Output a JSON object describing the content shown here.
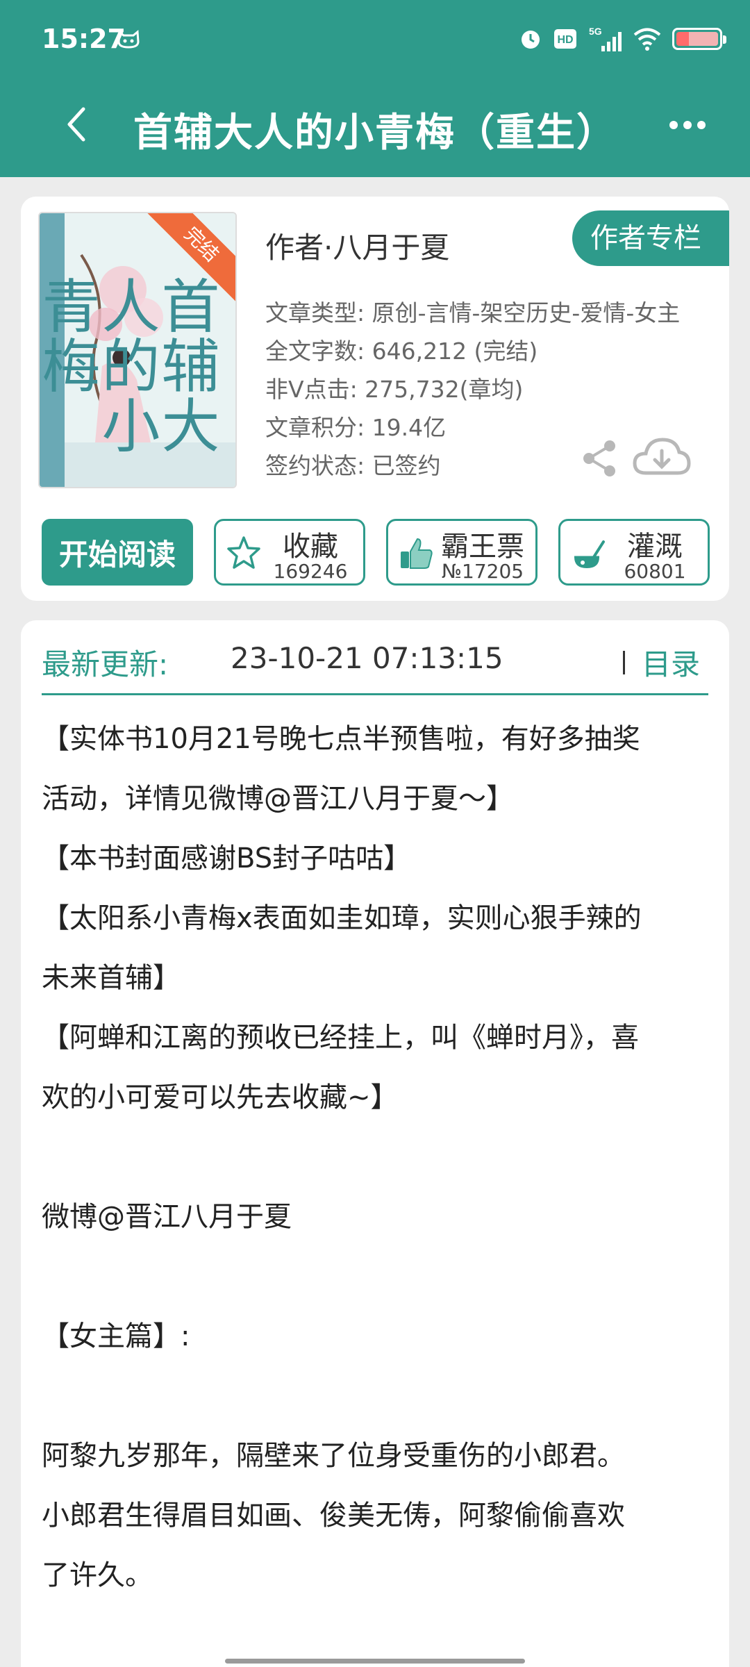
{
  "status_bar": {
    "time": "15:27",
    "icons": [
      "cat-icon",
      "alarm-icon",
      "hd-icon",
      "signal-5g-icon",
      "wifi-icon",
      "battery-icon"
    ],
    "network_label": "5G",
    "hd_label": "HD"
  },
  "header": {
    "title": "首辅大人的小青梅（重生）",
    "back_icon": "chevron-left-icon",
    "more_icon": "more-dots-icon"
  },
  "book": {
    "cover_badge": "完结",
    "cover_title": "首辅大人的小青梅",
    "author_label": "作者·八月于夏",
    "author_column_button": "作者专栏",
    "info": [
      "文章类型: 原创-言情-架空历史-爱情-女主",
      "全文字数: 646,212 (完结)",
      "非V点击: 275,732(章均)",
      "文章积分: 19.4亿",
      "签约状态: 已签约"
    ]
  },
  "actions": {
    "read": "开始阅读",
    "favorite": {
      "label": "收藏",
      "count": "169246"
    },
    "bawangpiao": {
      "label": "霸王票",
      "count": "№17205"
    },
    "irrigate": {
      "label": "灌溉",
      "count": "60801"
    }
  },
  "latest": {
    "label": "最新更新:",
    "time": "23-10-21 07:13:15",
    "toc": "目录"
  },
  "description": "【实体书10月21号晚七点半预售啦，有好多抽奖\n活动，详情见微博@晋江八月于夏～】\n【本书封面感谢BS封子咕咕】\n【太阳系小青梅x表面如圭如璋，实则心狠手辣的\n未来首辅】\n【阿蝉和江离的预收已经挂上，叫《蝉时月》，喜\n欢的小可爱可以先去收藏~】\n\n微博@晋江八月于夏\n\n【女主篇】:\n\n阿黎九岁那年，隔壁来了位身受重伤的小郎君。\n小郎君生得眉目如画、俊美无俦，阿黎偷偷喜欢\n了许久。",
  "colors": {
    "accent": "#2e9b8b",
    "background": "#ececec",
    "badge": "#ef6b3b"
  }
}
